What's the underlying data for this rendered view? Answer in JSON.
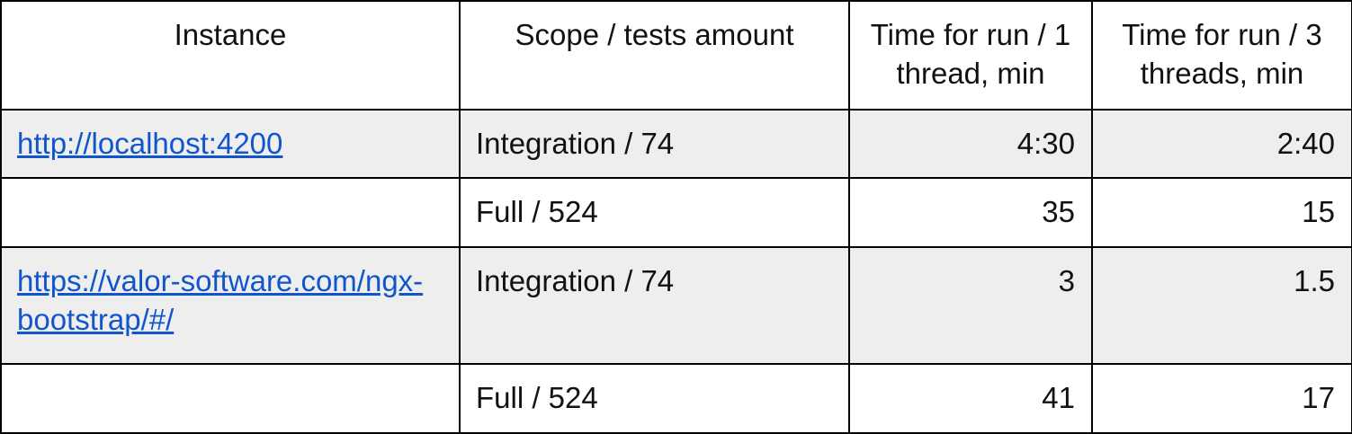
{
  "table": {
    "headers": [
      "Instance",
      "Scope / tests amount",
      "Time for run / 1 thread, min",
      "Time for run / 3 threads, min"
    ],
    "rows": [
      {
        "instance": "http://localhost:4200",
        "scope": "Integration / 74",
        "time_1_thread": "4:30",
        "time_3_threads": "2:40"
      },
      {
        "instance": "",
        "scope": "Full / 524",
        "time_1_thread": "35",
        "time_3_threads": "15"
      },
      {
        "instance": "https://valor-software.com/ngx-bootstrap/#/",
        "scope": "Integration / 74",
        "time_1_thread": "3",
        "time_3_threads": "1.5"
      },
      {
        "instance": "",
        "scope": "Full / 524",
        "time_1_thread": "41",
        "time_3_threads": "17"
      }
    ]
  },
  "colors": {
    "link": "#1155cc",
    "shaded_row": "#eeeeee",
    "border": "#000000"
  }
}
